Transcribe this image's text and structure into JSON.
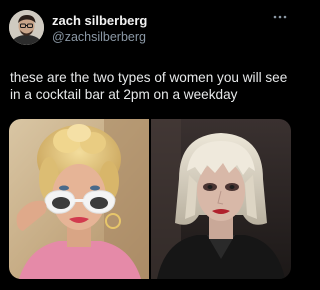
{
  "tweet": {
    "display_name": "zach silberberg",
    "handle": "@zachsilberberg",
    "text": "these are the two types of women you will see\nin a cocktail bar at 2pm on a weekday",
    "more_icon": "more-horizontal-icon",
    "media": [
      {
        "subject": "blonde woman with updo lowering white cat-eye sunglasses, pink top, sunlit background"
      },
      {
        "subject": "woman with platinum shaggy bob and bangs, dark makeup, red lipstick, dark coat, dark background"
      }
    ]
  },
  "colors": {
    "background": "#000000",
    "text_primary": "#e7e9ea",
    "text_secondary": "#8b98a5"
  }
}
